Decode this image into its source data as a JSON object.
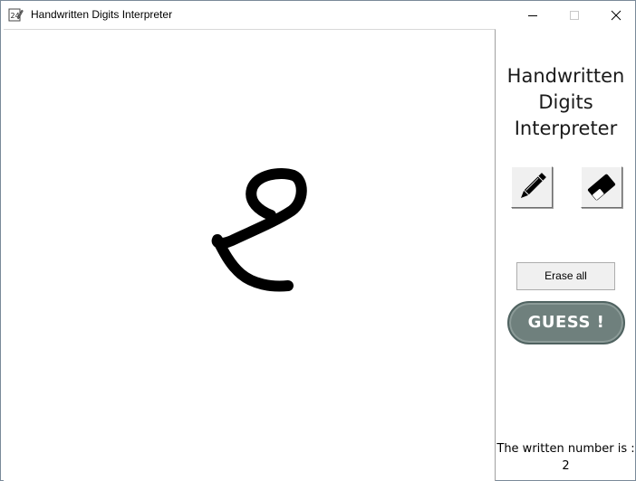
{
  "window": {
    "title": "Handwritten Digits Interpreter",
    "icon": "digits-app-icon",
    "controls": [
      "minimize-icon",
      "maximize-icon",
      "close-icon"
    ]
  },
  "canvas": {
    "background": "#ffffff",
    "stroke_color": "#000000",
    "drawn_glyph": "handwritten-digit-stroke"
  },
  "side_panel": {
    "heading_lines": [
      "Handwritten",
      "Digits",
      "Interpreter"
    ],
    "tools": [
      {
        "name": "pencil",
        "icon": "pencil-icon"
      },
      {
        "name": "eraser",
        "icon": "eraser-icon"
      }
    ],
    "erase_all_label": "Erase all",
    "guess_label": "GUESS !",
    "guess_color": "#6f807d",
    "result_label": "The written number is :",
    "result_value": "2"
  }
}
